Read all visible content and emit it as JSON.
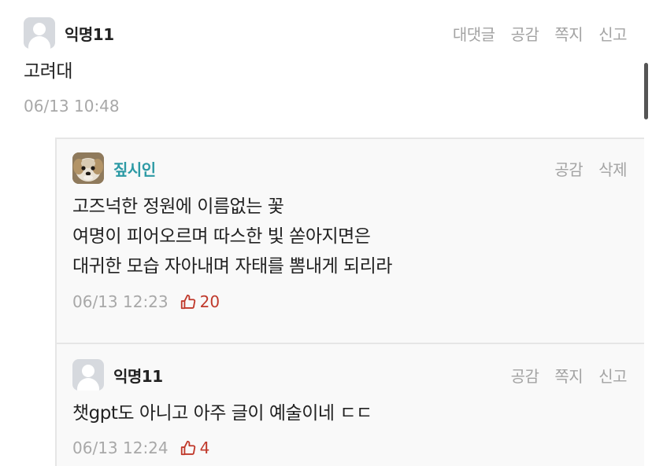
{
  "comment": {
    "author": "익명11",
    "actions": [
      "대댓글",
      "공감",
      "쪽지",
      "신고"
    ],
    "content": "고려대",
    "timestamp": "06/13 10:48"
  },
  "replies": [
    {
      "author": "짚시인",
      "actions": [
        "공감",
        "삭제"
      ],
      "lines": [
        "고즈넉한 정원에 이름없는 꽃",
        "여명이 피어오르며 따스한 빛 쏟아지면은",
        "대귀한 모습 자아내며 자태를 뽐내게 되리라"
      ],
      "timestamp": "06/13 12:23",
      "likes": "20"
    },
    {
      "author": "익명11",
      "actions": [
        "공감",
        "쪽지",
        "신고"
      ],
      "content": "챗gpt도 아니고 아주 글이 예술이네 ㄷㄷ",
      "timestamp": "06/13 12:24",
      "likes": "4"
    }
  ],
  "colors": {
    "like": "#c0392b",
    "author_highlight": "#2d9aa5",
    "muted": "#a3a3a3"
  }
}
